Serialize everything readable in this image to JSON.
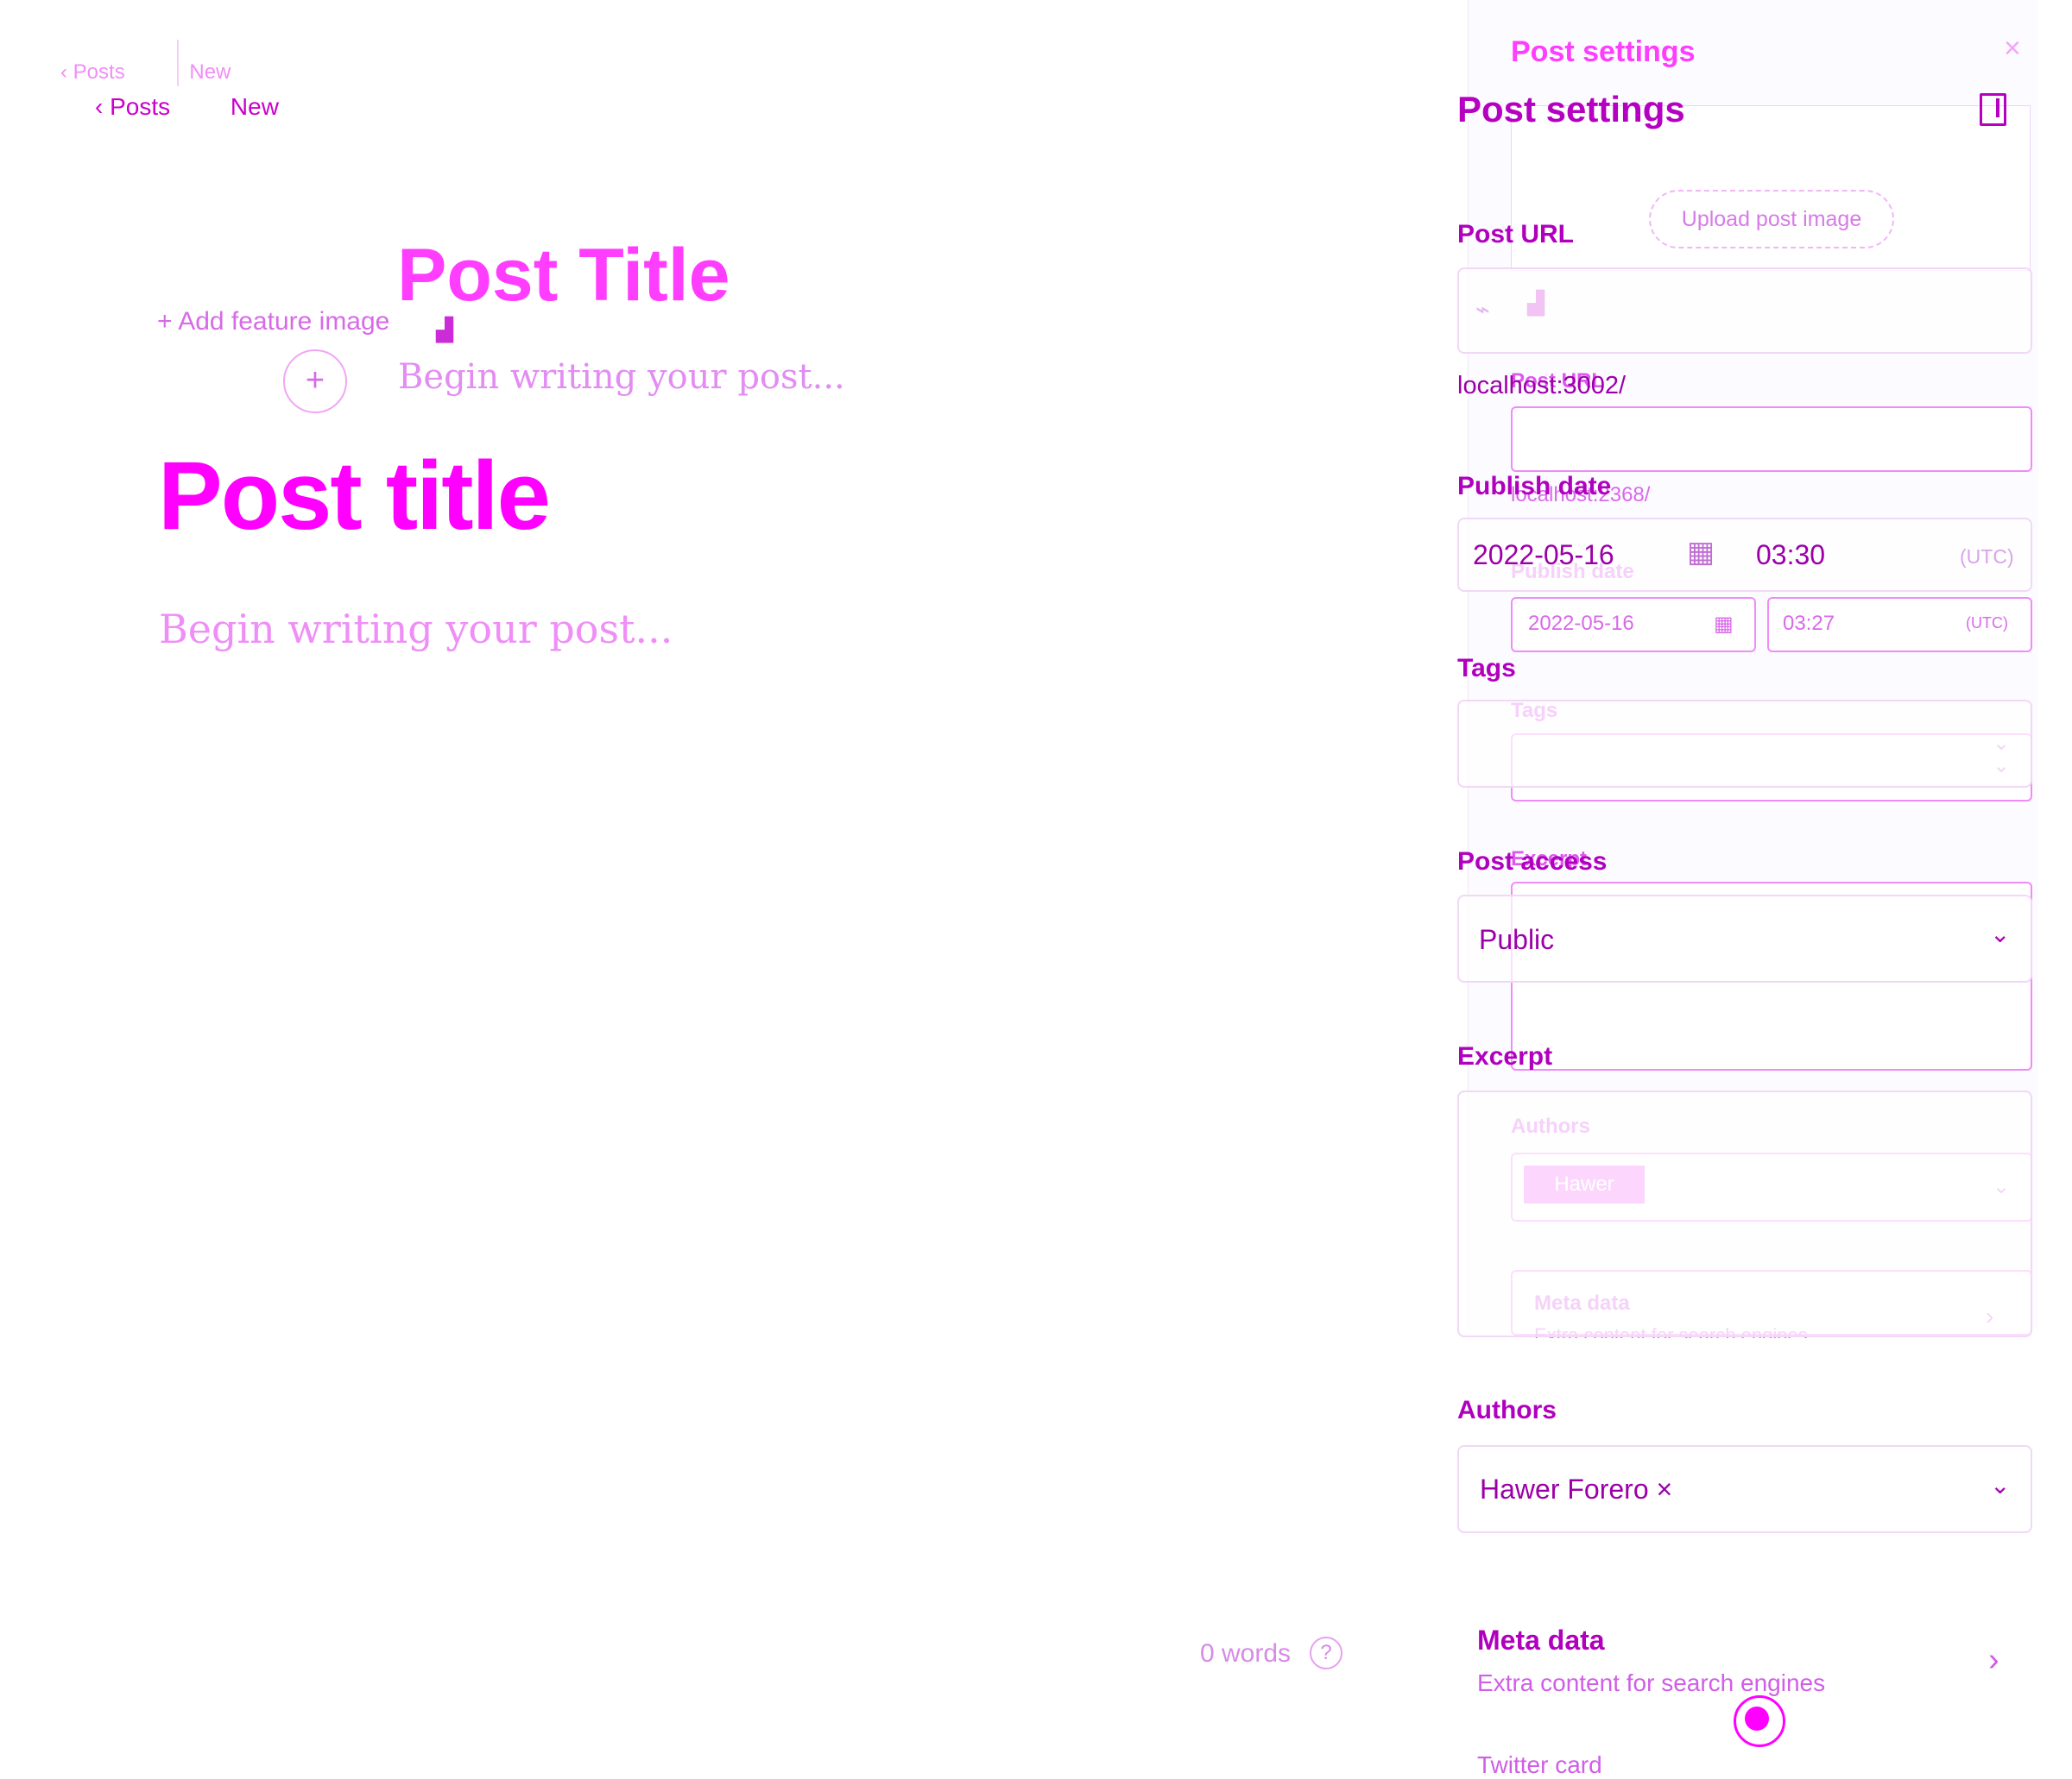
{
  "breadcrumbs": {
    "ghost": {
      "back": "Posts",
      "current": "New"
    },
    "main": {
      "back": "Posts",
      "current": "New"
    }
  },
  "editor": {
    "ghost_title": "Post Title",
    "title_placeholder": "Post title",
    "body_placeholder": "Begin writing your post...",
    "add_feature": "Add feature image",
    "word_count": "0 words",
    "help_label": "?"
  },
  "sidebar": {
    "title": "Post settings",
    "ghost": {
      "title": "Post settings",
      "upload_label": "Upload post image",
      "post_url_label": "Post URL",
      "post_url_value": "localhost:2368/",
      "publish_date_label": "Publish date",
      "publish_date": "2022-05-16",
      "publish_time": "03:27",
      "utc": "UTC",
      "tags_label": "Tags",
      "excerpt_label": "Excerpt",
      "authors_label": "Authors",
      "author_tag": "Hawer",
      "meta_title": "Meta data",
      "meta_sub": "Extra content for search engines"
    },
    "post_url": {
      "label": "Post URL",
      "value": "localhost:3002/"
    },
    "publish": {
      "label": "Publish date",
      "date": "2022-05-16",
      "time": "03:30",
      "utc": "UTC"
    },
    "tags": {
      "label": "Tags"
    },
    "post_access": {
      "label": "Post access",
      "value": "Public"
    },
    "excerpt": {
      "label": "Excerpt"
    },
    "authors": {
      "label": "Authors",
      "value": "Hawer Forero",
      "remove_label": "×"
    },
    "meta_data": {
      "title": "Meta data",
      "subtitle": "Extra content for search engines"
    },
    "cutoff_label": "Twitter card"
  },
  "icons": {
    "back": "chevron-left-icon",
    "plus": "plus-icon",
    "calendar": "calendar-icon",
    "link": "link-icon",
    "toggle": "sidebar-toggle-icon",
    "chevron_down": "chevron-down-icon",
    "chevron_right": "chevron-right-icon",
    "support": "support-icon"
  },
  "colors": {
    "accent": "#ff00ff",
    "accent_dark": "#b000be",
    "muted": "#d27ae3"
  }
}
